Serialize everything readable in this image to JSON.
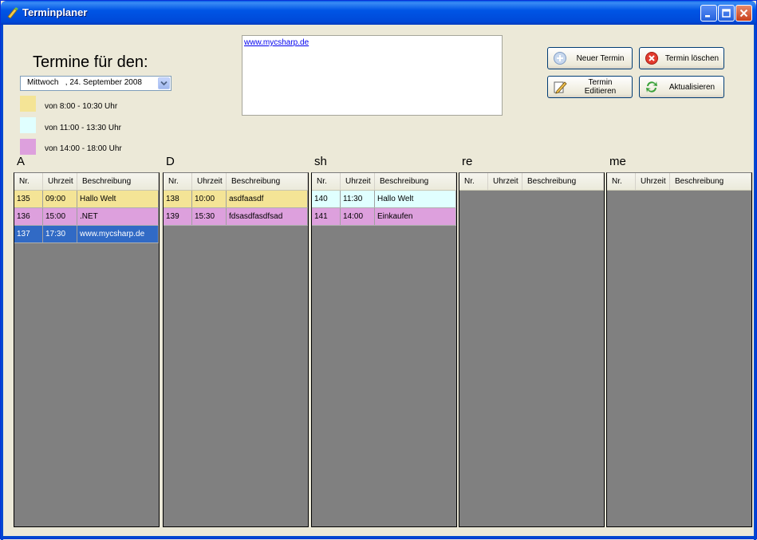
{
  "window": {
    "title": "Terminplaner"
  },
  "heading": "Termine für den:",
  "date_picker": {
    "value": "Mittwoch   , 24. September 2008"
  },
  "legend": [
    {
      "label": "von 8:00 - 10:30 Uhr",
      "color": "#f4e496"
    },
    {
      "label": "von 11:00 - 13:30 Uhr",
      "color": "#e0ffff"
    },
    {
      "label": "von 14:00 - 18:00 Uhr",
      "color": "#dda0dd"
    }
  ],
  "notes": {
    "link": "www.mycsharp.de"
  },
  "buttons": {
    "new": "Neuer Termin",
    "delete": "Termin löschen",
    "edit": "Termin Editieren",
    "refresh": "Aktualisieren"
  },
  "columns_header": {
    "nr": "Nr.",
    "time": "Uhrzeit",
    "desc": "Beschreibung"
  },
  "selection_color": "#316ac5",
  "days": [
    {
      "title": "A",
      "rows": [
        {
          "nr": "135",
          "time": "09:00",
          "desc": "Hallo Welt",
          "color": "#f4e496"
        },
        {
          "nr": "136",
          "time": "15:00",
          "desc": ".NET",
          "color": "#dda0dd"
        },
        {
          "nr": "137",
          "time": "17:30",
          "desc": "www.mycsharp.de",
          "color": "#316ac5",
          "selected": true
        }
      ]
    },
    {
      "title": "D",
      "rows": [
        {
          "nr": "138",
          "time": "10:00",
          "desc": "asdfaasdf",
          "color": "#f4e496"
        },
        {
          "nr": "139",
          "time": "15:30",
          "desc": "fdsasdfasdfsad",
          "color": "#dda0dd"
        }
      ]
    },
    {
      "title": "sh",
      "rows": [
        {
          "nr": "140",
          "time": "11:30",
          "desc": "Hallo Welt",
          "color": "#e0ffff"
        },
        {
          "nr": "141",
          "time": "14:00",
          "desc": "Einkaufen",
          "color": "#dda0dd"
        }
      ]
    },
    {
      "title": "re",
      "rows": []
    },
    {
      "title": "me",
      "rows": []
    }
  ]
}
